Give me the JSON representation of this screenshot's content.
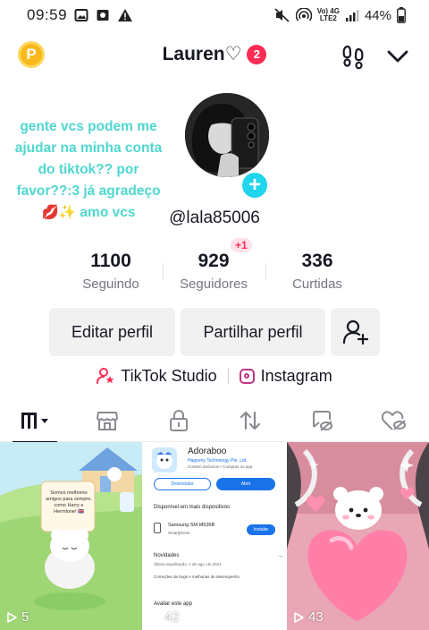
{
  "status_bar": {
    "time": "09:59",
    "battery": "44%",
    "network_top": "Vo) 4G",
    "network_bottom": "LTE2"
  },
  "header": {
    "username": "Lauren♡",
    "notification_count": "2",
    "coin_letter": "P"
  },
  "profile": {
    "note": "gente vcs podem me ajudar na minha conta do tiktok?? por favor??:3 já agradeço 💋✨ amo vcs",
    "handle": "@lala85006"
  },
  "stats": {
    "following_count": "1100",
    "following_label": "Seguindo",
    "followers_count": "929",
    "followers_label": "Seguidores",
    "followers_new": "+1",
    "likes_count": "336",
    "likes_label": "Curtidas"
  },
  "buttons": {
    "edit_profile": "Editar perfil",
    "share_profile": "Partilhar perfil"
  },
  "links": {
    "studio": "TikTok Studio",
    "instagram": "Instagram"
  },
  "videos": [
    {
      "views": "5",
      "bubble_text": "Somos melhores amigos para sempre, como Harry e Hermione! 🇬🇧"
    },
    {
      "views": "42",
      "app_name": "Adoraboo",
      "publisher": "Happeny Technology Pte. Ltd.",
      "purchase_note": "Contém anúncios • Compras no app",
      "uninstall_label": "Desinstalar",
      "open_label": "Abrir",
      "devices_heading": "Disponível em mais dispositivos",
      "device_name": "Samsung SM-M536B",
      "device_sub": "Smartphone",
      "install_label": "Instalar",
      "news_heading": "Novidades",
      "news_date": "Última atualização: 1 de ago. de 2024",
      "news_body": "Correções de bugs e melhorias de desempenho",
      "rate_heading": "Avaliar este app"
    },
    {
      "views": "43"
    }
  ],
  "colors": {
    "accent_pink": "#fe2c55",
    "accent_cyan": "#20d5ec",
    "note_text": "#4fd7d0",
    "coin": "#f9b81b"
  }
}
